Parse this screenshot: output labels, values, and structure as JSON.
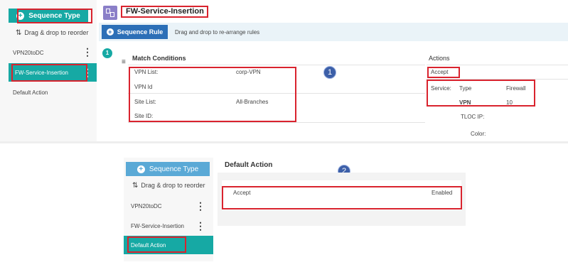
{
  "top": {
    "sidebar": {
      "sequence_type_label": "Sequence Type",
      "drag_reorder_label": "Drag & drop to reorder",
      "items": [
        {
          "label": "VPN20toDC"
        },
        {
          "label": "FW-Service-Insertion"
        },
        {
          "label": "Default Action"
        }
      ]
    },
    "title": "FW-Service-Insertion",
    "sequence_rule_label": "Sequence Rule",
    "drag_rules_hint": "Drag and drop to re-arrange rules",
    "rule_number": "1",
    "match_conditions_header": "Match Conditions",
    "actions_header": "Actions",
    "match": {
      "vpn_list_label": "VPN List:",
      "vpn_list_value": "corp-VPN",
      "vpn_id_label": "VPN Id",
      "site_list_label": "Site List:",
      "site_list_value": "All-Branches",
      "site_id_label": "Site ID:"
    },
    "actions": {
      "accept_label": "Accept",
      "service_label": "Service:",
      "type_label": "Type",
      "type_value": "Firewall",
      "vpn_label": "VPN",
      "vpn_value": "10",
      "tloc_ip_label": "TLOC IP:",
      "color_label": "Color:"
    },
    "callout": "1"
  },
  "bottom": {
    "sidebar": {
      "sequence_type_label": "Sequence Type",
      "drag_reorder_label": "Drag & drop to reorder",
      "items": [
        {
          "label": "VPN20toDC"
        },
        {
          "label": "FW-Service-Insertion"
        },
        {
          "label": "Default Action"
        }
      ]
    },
    "default_action_header": "Default Action",
    "accept_label": "Accept",
    "enabled_label": "Enabled",
    "callout": "2"
  },
  "colors": {
    "teal": "#16a9a4",
    "highlight_red": "#d9232e",
    "blue_button": "#2c6fb7"
  }
}
